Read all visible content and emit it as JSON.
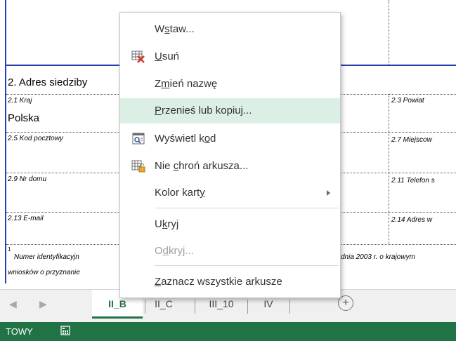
{
  "form": {
    "section_title": "2. Adres siedziby",
    "labels": {
      "kraj": "2.1 Kraj",
      "kod": "2.5 Kod pocztowy",
      "nr_domu": "2.9 Nr domu",
      "email": "2.13  E-mail",
      "powiat": "2.3 Powiat",
      "miejscowosc": "2.7 Miejscow",
      "telefon": "2.11 Telefon s",
      "adres_www": "2.14 Adres w"
    },
    "kraj_value": "Polska",
    "footnote_mark": "1",
    "footnote_line1_left": "Numer identyfikacyjn",
    "footnote_line1_right": "dnia 2003 r. o krajowym",
    "footnote_line2": "wniosków o przyznanie"
  },
  "tabs": {
    "items": [
      "II_B",
      "II_C",
      "III_10",
      "IV"
    ],
    "active": "II_B",
    "add": "+"
  },
  "status": {
    "mode": "TOWY"
  },
  "context_menu": {
    "items": [
      {
        "pre": "W",
        "u": "s",
        "post": "taw...",
        "icon": "none",
        "state": "normal"
      },
      {
        "pre": "",
        "u": "U",
        "post": "suń",
        "icon": "delete-sheet-icon",
        "state": "normal"
      },
      {
        "pre": "Z",
        "u": "m",
        "post": "ień nazwę",
        "icon": "none",
        "state": "normal"
      },
      {
        "pre": "",
        "u": "P",
        "post": "rzenieś lub kopiuj...",
        "icon": "none",
        "state": "hover"
      },
      {
        "pre": "Wyświetl k",
        "u": "o",
        "post": "d",
        "icon": "view-code-icon",
        "state": "normal"
      },
      {
        "pre": "Nie ",
        "u": "c",
        "post": "hroń arkusza...",
        "icon": "unprotect-sheet-icon",
        "state": "normal"
      },
      {
        "pre": "Kolor kart",
        "u": "y",
        "post": "",
        "icon": "none",
        "state": "submenu"
      },
      {
        "pre": "U",
        "u": "k",
        "post": "ryj",
        "icon": "none",
        "state": "normal"
      },
      {
        "pre": "O",
        "u": "d",
        "post": "kryj...",
        "icon": "none",
        "state": "disabled"
      },
      {
        "pre": "",
        "u": "Z",
        "post": "aznacz wszystkie arkusze",
        "icon": "none",
        "state": "normal"
      }
    ]
  },
  "colors": {
    "excel_green": "#217346",
    "hover_green": "#dcefe4",
    "border_blue": "#2b3fb0"
  }
}
